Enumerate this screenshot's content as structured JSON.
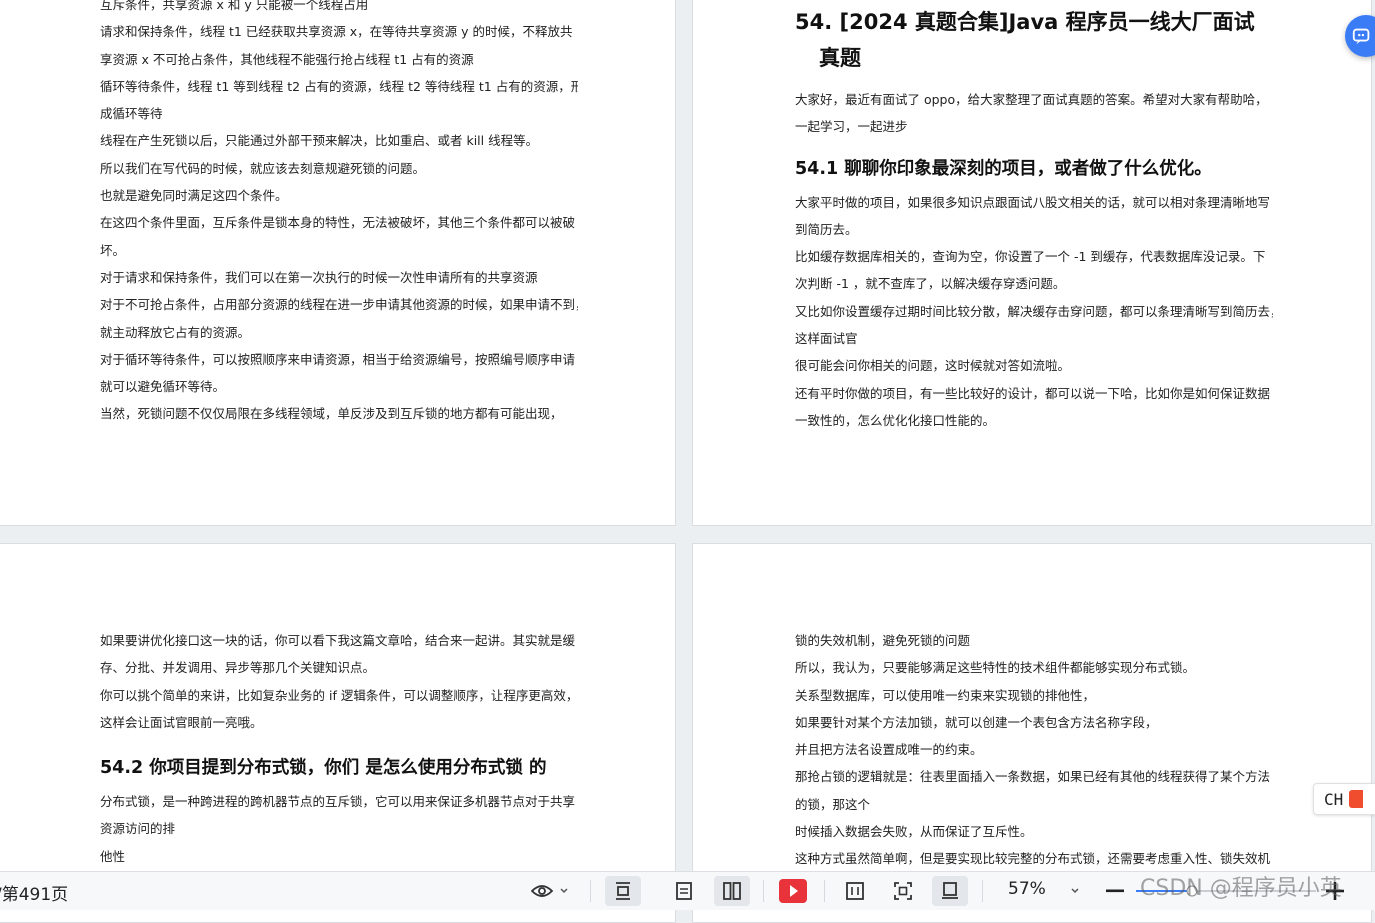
{
  "page_tl": {
    "lines": [
      "互斥条件，共享资源 x 和 y 只能被一个线程占用",
      "请求和保持条件，线程 t1 已经获取共享资源 x，在等待共享资源 y 的时候，不释放共",
      "享资源 x 不可抢占条件，其他线程不能强行抢占线程 t1 占有的资源",
      "循环等待条件，线程 t1 等到线程 t2 占有的资源，线程 t2 等待线程 t1 占有的资源，形",
      "成循环等待",
      "线程在产生死锁以后，只能通过外部干预来解决，比如重启、或者 kill 线程等。",
      "所以我们在写代码的时候，就应该去刻意规避死锁的问题。",
      "也就是避免同时满足这四个条件。",
      "在这四个条件里面，互斥条件是锁本身的特性，无法被破坏，其他三个条件都可以被破",
      "坏。",
      "对于请求和保持条件，我们可以在第一次执行的时候一次性申请所有的共享资源",
      "对于不可抢占条件，占用部分资源的线程在进一步申请其他资源的时候，如果申请不到，",
      "就主动释放它占有的资源。",
      "对于循环等待条件，可以按照顺序来申请资源，相当于给资源编号，按照编号顺序申请",
      "就可以避免循环等待。",
      "当然，死锁问题不仅仅局限在多线程领域，单反涉及到互斥锁的地方都有可能出现，"
    ]
  },
  "page_tr": {
    "title_line1": "54.  [2024 真题合集]Java 程序员一线大厂面试",
    "title_line2": "真题",
    "intro": [
      "大家好，最近有面试了 oppo，给大家整理了面试真题的答案。希望对大家有帮助哈，",
      "一起学习，一起进步"
    ],
    "section_title": "54.1  聊聊你印象最深刻的项目，或者做了什么优化。",
    "body": [
      "大家平时做的项目，如果很多知识点跟面试八股文相关的话，就可以相对条理清晰地写",
      "到简历去。",
      "比如缓存数据库相关的，查询为空，你设置了一个 -1 到缓存，代表数据库没记录。下",
      "次判断 -1 ，就不查库了，以解决缓存穿透问题。",
      "又比如你设置缓存过期时间比较分散，解决缓存击穿问题，都可以条理清晰写到简历去，",
      "这样面试官",
      "很可能会问你相关的问题，这时候就对答如流啦。",
      "还有平时你做的项目，有一些比较好的设计，都可以说一下哈，比如你是如何保证数据",
      "一致性的，怎么优化化接口性能的。"
    ]
  },
  "page_bl": {
    "lines_before": [
      "如果要讲优化接口这一块的话，你可以看下我这篇文章哈，结合来一起讲。其实就是缓",
      "存、分批、并发调用、异步等那几个关键知识点。",
      "你可以挑个简单的来讲，比如复杂业务的 if 逻辑条件，可以调整顺序，让程序更高效，",
      "这样会让面试官眼前一亮哦。"
    ],
    "section_title": "54.2  你项目提到分布式锁，你们 是怎么使用分布式锁 的",
    "lines_after": [
      "分布式锁，是一种跨进程的跨机器节点的互斥锁，它可以用来保证多机器节点对于共享",
      "资源访问的排",
      "他性"
    ]
  },
  "page_br": {
    "lines": [
      "锁的失效机制，避免死锁的问题",
      "所以，我认为，只要能够满足这些特性的技术组件都能够实现分布式锁。",
      "关系型数据库，可以使用唯一约束来实现锁的排他性，",
      "如果要针对某个方法加锁，就可以创建一个表包含方法名称字段，",
      "并且把方法名设置成唯一的约束。",
      "那抢占锁的逻辑就是：往表里面插入一条数据，如果已经有其他的线程获得了某个方法",
      "的锁，那这个",
      "时候插入数据会失败，从而保证了互斥性。",
      "这种方式虽然简单啊，但是要实现比较完整的分布式锁，还需要考虑重入性、锁失效机"
    ]
  },
  "ime": {
    "text": "CH"
  },
  "toolbar": {
    "page_info": "/第491页",
    "zoom": "57%",
    "icons": [
      "eye-icon",
      "chevron-down-icon",
      "continuous-scroll-icon",
      "single-page-icon",
      "dual-page-icon",
      "play-icon",
      "fit-width-icon",
      "fit-page-icon",
      "page-layout-icon",
      "chevron-down-icon",
      "zoom-out-icon",
      "zoom-in-icon"
    ]
  },
  "watermark": "CSDN @程序员小英",
  "colors": {
    "accent": "#3a7bf6",
    "play": "#e8333a",
    "background": "#eceff2"
  }
}
